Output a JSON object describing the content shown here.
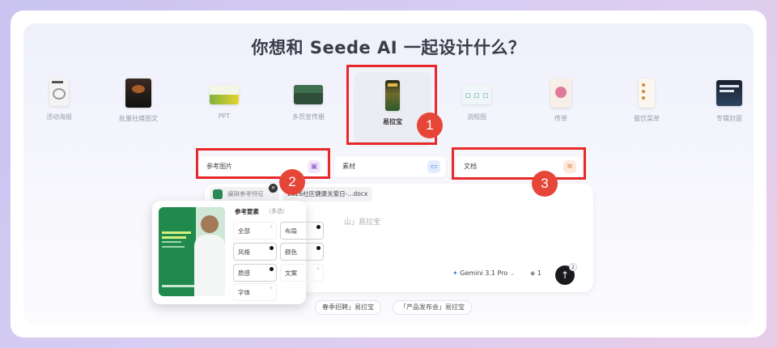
{
  "headline": "你想和 Seede AI 一起设计什么？",
  "categories": [
    {
      "label": "活动海报",
      "icon": "poster-thumb"
    },
    {
      "label": "批量社媒图文",
      "icon": "social-post-thumb"
    },
    {
      "label": "PPT",
      "icon": "ppt-thumb"
    },
    {
      "label": "多页宣传册",
      "icon": "brochure-thumb"
    },
    {
      "label": "易拉宝",
      "icon": "rollup-banner-thumb"
    },
    {
      "label": "流程图",
      "icon": "flowchart-thumb"
    },
    {
      "label": "传单",
      "icon": "flyer-thumb"
    },
    {
      "label": "餐饮菜单",
      "icon": "menu-thumb"
    },
    {
      "label": "专辑封面",
      "icon": "album-cover-thumb"
    }
  ],
  "callouts": [
    "1",
    "2",
    "3"
  ],
  "upload": {
    "reference": "参考图片",
    "material": "素材",
    "document": "文档"
  },
  "input": {
    "edit_reference": "编辑参考特征",
    "file_chip": "2026社区健康关爱日-...docx",
    "prompt_fragment": "山」易拉宝",
    "model": "Gemini 3.1 Pro",
    "count": "1",
    "send_badge": "2"
  },
  "suggestions": [
    "春季招聘」易拉宝",
    "「产品发布会」易拉宝"
  ],
  "reference_popup": {
    "title": "参考要素",
    "hint": "（多选）",
    "options": [
      {
        "label": "全部",
        "selected": false
      },
      {
        "label": "布局",
        "selected": true
      },
      {
        "label": "风格",
        "selected": true
      },
      {
        "label": "颜色",
        "selected": true
      },
      {
        "label": "质感",
        "selected": true
      },
      {
        "label": "文案",
        "selected": false
      },
      {
        "label": "字体",
        "selected": false
      }
    ],
    "preview_text": "Kita mau\nmenginspirasi\nCarilah rsi\nuntuk ini\nsesuatu",
    "preview_brand": "Hospitalabit"
  },
  "colors": {
    "accent_red": "#e8292a",
    "badge_red": "#e64637",
    "preview_green": "#1f8a4c"
  }
}
